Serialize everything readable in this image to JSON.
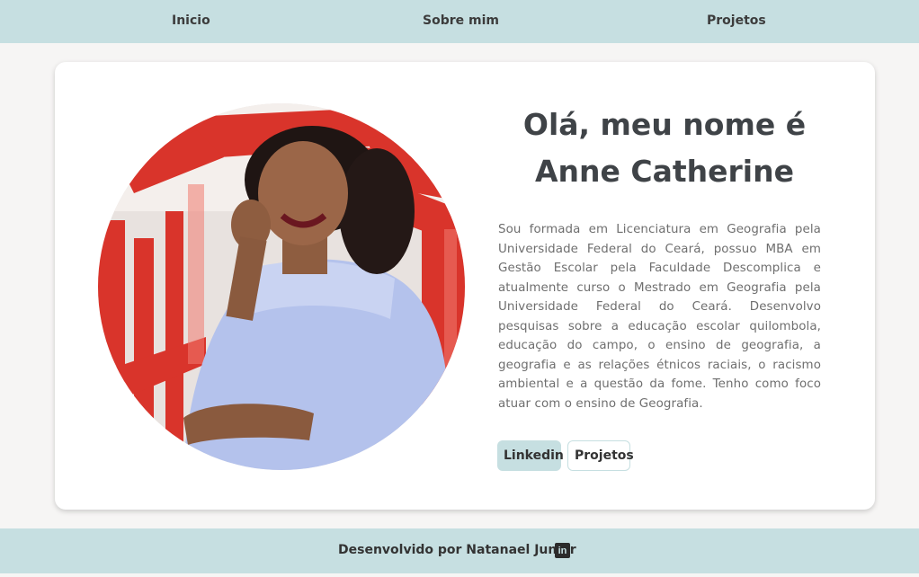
{
  "nav": {
    "items": [
      {
        "label": "Inicio"
      },
      {
        "label": "Sobre mim"
      },
      {
        "label": "Projetos"
      }
    ]
  },
  "hero": {
    "title_line1": "Olá, meu nome é",
    "title_line2": "Anne Catherine",
    "bio": "Sou formada em Licenciatura em Geografia pela Universidade Federal do Ceará, possuo MBA em Gestão Escolar pela Faculdade Descomplica e atualmente curso o Mestrado em Geografia pela Universidade Federal do Ceará. Desenvolvo pesquisas sobre a educação escolar quilombola, educação do campo, o ensino de geografia, a geografia e as relações étnicos raciais, o racismo ambiental e a questão da fome. Tenho como foco atuar com o ensino de Geografia.",
    "buttons": {
      "linkedin": "Linkedin",
      "projetos": "Projetos"
    },
    "photo_icon": "profile-photo"
  },
  "footer": {
    "text": "Desenvolvido por Natanael Junior",
    "icon": "linkedin-icon"
  },
  "colors": {
    "accent": "#c6dfe1",
    "background": "#f6f5f4",
    "card": "#ffffff",
    "text": "#333333"
  }
}
